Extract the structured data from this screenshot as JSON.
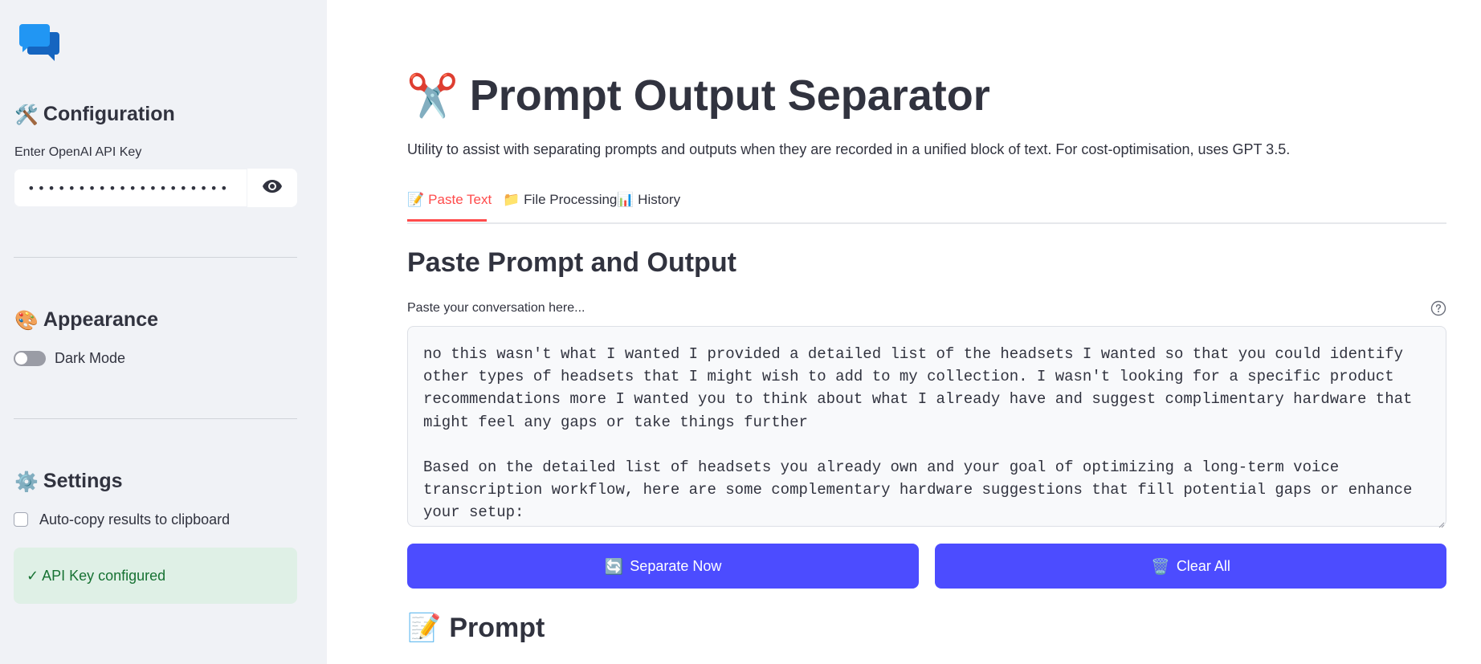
{
  "sidebar": {
    "configuration": {
      "emoji": "🛠️",
      "title": "Configuration"
    },
    "api_key": {
      "label": "Enter OpenAI API Key",
      "masked_value": "••••••••••••••••••••",
      "toggle_icon": "eye-icon"
    },
    "appearance": {
      "emoji": "🎨",
      "title": "Appearance"
    },
    "dark_mode": {
      "label": "Dark Mode",
      "enabled": false
    },
    "settings": {
      "emoji": "⚙️",
      "title": "Settings"
    },
    "auto_copy": {
      "label": "Auto-copy results to clipboard",
      "checked": false
    },
    "status": {
      "text": "✓ API Key configured"
    }
  },
  "main": {
    "title_emoji": "✂️",
    "title": "Prompt Output Separator",
    "subtitle": "Utility to assist with separating prompts and outputs when they are recorded in a unified block of text. For cost-optimisation, uses GPT 3.5.",
    "tabs": [
      {
        "emoji": "📝",
        "label": "Paste Text",
        "active": true
      },
      {
        "emoji": "📁",
        "label": "File Processing",
        "active": false
      },
      {
        "emoji": "📊",
        "label": "History",
        "active": false
      }
    ],
    "section_heading": "Paste Prompt and Output",
    "textarea_label": "Paste your conversation here...",
    "textarea_value": "no this wasn't what I wanted I provided a detailed list of the headsets I wanted so that you could identify other types of headsets that I might wish to add to my collection. I wasn't looking for a specific product recommendations more I wanted you to think about what I already have and suggest complimentary hardware that might feel any gaps or take things further\n\nBased on the detailed list of headsets you already own and your goal of optimizing a long-term voice transcription workflow, here are some complementary hardware suggestions that fill potential gaps or enhance your setup:",
    "buttons": {
      "separate": {
        "emoji": "🔄",
        "label": "Separate Now"
      },
      "clear": {
        "emoji": "🗑️",
        "label": "Clear All"
      }
    },
    "prompt_heading": {
      "emoji": "📝",
      "label": "Prompt"
    }
  },
  "colors": {
    "sidebar_bg": "#f0f2f6",
    "primary_button": "#4c4cff",
    "active_tab": "#ff4b4b",
    "success_bg": "#dff0e6",
    "success_text": "#177233"
  }
}
